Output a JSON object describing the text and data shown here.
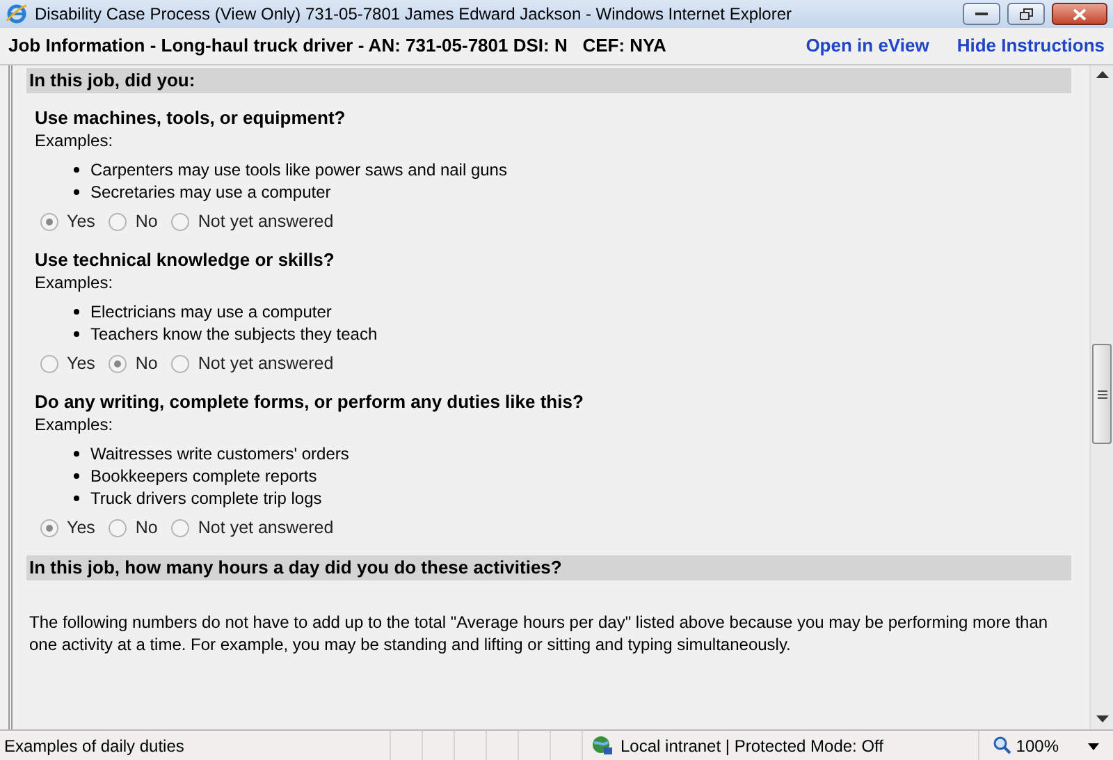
{
  "window": {
    "title": "Disability Case Process (View Only) 731-05-7801 James Edward Jackson - Windows Internet Explorer"
  },
  "header": {
    "title": "Job Information - Long-haul truck driver - AN: 731-05-7801 DSI: N   CEF: NYA",
    "links": [
      "Open in eView",
      "Hide Instructions"
    ]
  },
  "sections": [
    {
      "heading": "In this job, did you:",
      "questions": [
        {
          "question": "Use machines, tools, or equipment?",
          "examples_label": "Examples:",
          "examples": [
            "Carpenters may use tools like power saws and nail guns",
            "Secretaries may use a computer"
          ],
          "options": [
            {
              "label": "Yes",
              "selected": true,
              "disabled": true
            },
            {
              "label": "No",
              "selected": false,
              "disabled": true
            },
            {
              "label": "Not yet answered",
              "selected": false,
              "disabled": true
            }
          ]
        },
        {
          "question": "Use technical knowledge or skills?",
          "examples_label": "Examples:",
          "examples": [
            "Electricians may use a computer",
            "Teachers know the subjects they teach"
          ],
          "options": [
            {
              "label": "Yes",
              "selected": false,
              "disabled": true
            },
            {
              "label": "No",
              "selected": true,
              "disabled": true
            },
            {
              "label": "Not yet answered",
              "selected": false,
              "disabled": true
            }
          ]
        },
        {
          "question": "Do any writing, complete forms, or perform any duties like this?",
          "examples_label": "Examples:",
          "examples": [
            "Waitresses write customers' orders",
            "Bookkeepers complete reports",
            "Truck drivers complete trip logs"
          ],
          "options": [
            {
              "label": "Yes",
              "selected": true,
              "disabled": true
            },
            {
              "label": "No",
              "selected": false,
              "disabled": true
            },
            {
              "label": "Not yet answered",
              "selected": false,
              "disabled": true
            }
          ]
        }
      ]
    },
    {
      "heading": "In this job, how many hours a day did you do these activities?",
      "text": "The following numbers do not have to add up to the total \"Average hours per day\" listed above because you may be performing more than one activity at a time. For example, you may be standing and lifting or sitting and typing simultaneously."
    }
  ],
  "status_bar": {
    "text": "Examples of daily duties",
    "zone": "Local intranet | Protected Mode: Off",
    "zoom": "100%"
  }
}
